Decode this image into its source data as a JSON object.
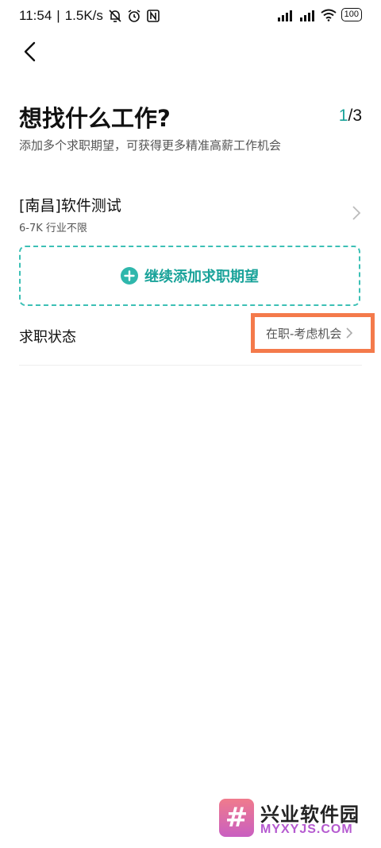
{
  "status_bar": {
    "time": "11:54",
    "speed": "1.5K/s",
    "battery": "100"
  },
  "header": {
    "title": "想找什么工作?",
    "step_current": "1",
    "step_total": "/3",
    "subtitle": "添加多个求职期望，可获得更多精准高薪工作机会"
  },
  "job_expectation": {
    "title": "[南昌]软件测试",
    "meta": "6-7K 行业不限"
  },
  "add_button": {
    "label": "继续添加求职期望"
  },
  "job_status": {
    "label": "求职状态",
    "value": "在职-考虑机会"
  },
  "watermark": {
    "logo": "#",
    "name": "兴业软件园",
    "domain": "MYXYJS.COM"
  },
  "colors": {
    "accent": "#1aa39a",
    "highlight_border": "#f47a4b"
  }
}
